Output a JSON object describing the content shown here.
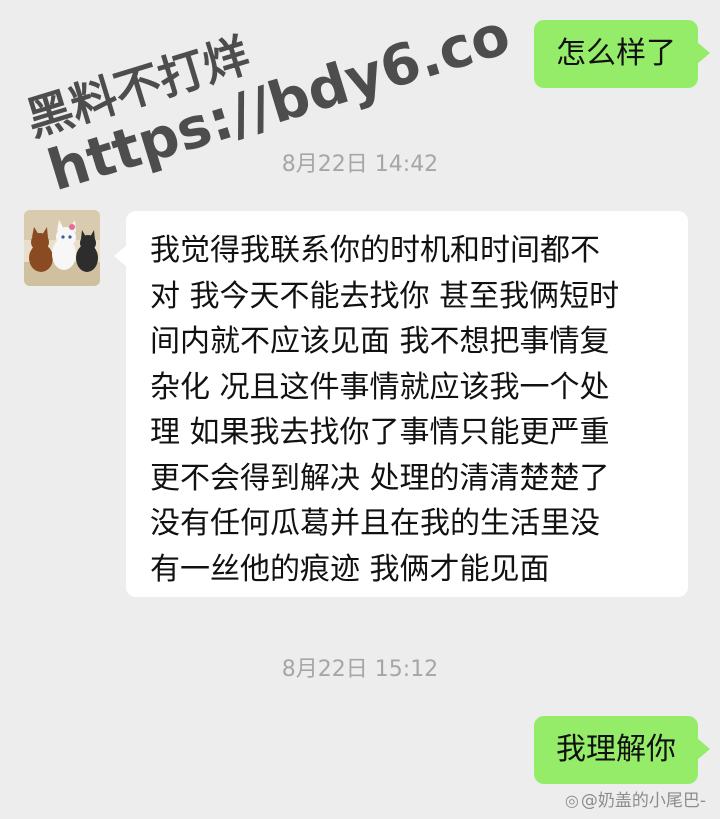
{
  "messages": [
    {
      "from": "me",
      "text": "怎么样了"
    },
    {
      "time": "8月22日 14:42"
    },
    {
      "from": "other",
      "lines": [
        "我觉得我联系你的时机和时间都不",
        "对 我今天不能去找你 甚至我俩短时",
        "间内就不应该见面 我不想把事情复",
        "杂化 况且这件事情就应该我一个处",
        "理 如果我去找你了事情只能更严重",
        "更不会得到解决 处理的清清楚楚了",
        "没有任何瓜葛并且在我的生活里没",
        "有一丝他的痕迹 我俩才能见面"
      ]
    },
    {
      "time": "8月22日 15:12"
    },
    {
      "from": "me",
      "text": "我理解你"
    }
  ],
  "avatar": {
    "icon": "cartoon-cats-avatar"
  },
  "watermark": {
    "line1": "黑料不打烊",
    "line2": "https://bdy6.co"
  },
  "credit": {
    "icon": "weibo-icon",
    "text": "@奶盖的小尾巴-"
  },
  "colors": {
    "background": "#ededed",
    "outgoing_bubble": "#95ec69",
    "incoming_bubble": "#ffffff",
    "timestamp": "#a6a6a6"
  }
}
